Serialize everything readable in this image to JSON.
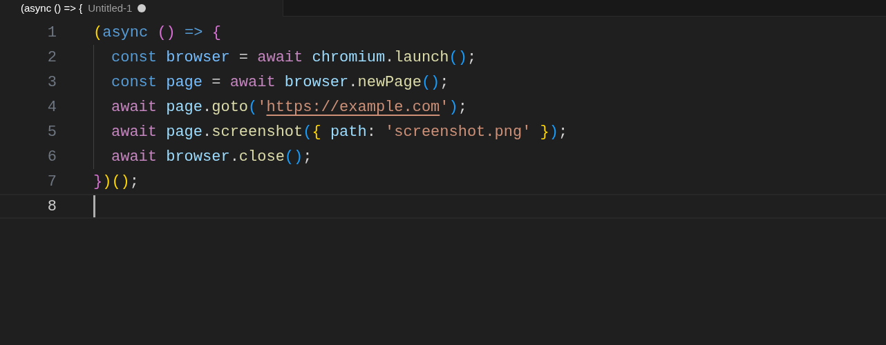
{
  "tab": {
    "title": "(async () => {",
    "subtitle": "Untitled-1",
    "dirty": true,
    "selected": true
  },
  "lines": [
    {
      "number": "1",
      "indented": false,
      "active": false,
      "tokens": [
        {
          "text": "(",
          "kind": "bracket1"
        },
        {
          "text": "async ",
          "kind": "keyword"
        },
        {
          "text": "() ",
          "kind": "bracket2"
        },
        {
          "text": "=> ",
          "kind": "keyword"
        },
        {
          "text": "{",
          "kind": "bracket2"
        }
      ]
    },
    {
      "number": "2",
      "indented": true,
      "active": false,
      "tokens": [
        {
          "text": "const ",
          "kind": "keyword"
        },
        {
          "text": "browser",
          "kind": "constant"
        },
        {
          "text": " = ",
          "kind": "plain"
        },
        {
          "text": "await ",
          "kind": "control"
        },
        {
          "text": "chromium",
          "kind": "variable"
        },
        {
          "text": ".",
          "kind": "plain"
        },
        {
          "text": "launch",
          "kind": "function"
        },
        {
          "text": "()",
          "kind": "bracket3"
        },
        {
          "text": ";",
          "kind": "plain"
        }
      ]
    },
    {
      "number": "3",
      "indented": true,
      "active": false,
      "tokens": [
        {
          "text": "const ",
          "kind": "keyword"
        },
        {
          "text": "page",
          "kind": "constant"
        },
        {
          "text": " = ",
          "kind": "plain"
        },
        {
          "text": "await ",
          "kind": "control"
        },
        {
          "text": "browser",
          "kind": "variable"
        },
        {
          "text": ".",
          "kind": "plain"
        },
        {
          "text": "newPage",
          "kind": "function"
        },
        {
          "text": "()",
          "kind": "bracket3"
        },
        {
          "text": ";",
          "kind": "plain"
        }
      ]
    },
    {
      "number": "4",
      "indented": true,
      "active": false,
      "tokens": [
        {
          "text": "await ",
          "kind": "control"
        },
        {
          "text": "page",
          "kind": "variable"
        },
        {
          "text": ".",
          "kind": "plain"
        },
        {
          "text": "goto",
          "kind": "function"
        },
        {
          "text": "(",
          "kind": "bracket3"
        },
        {
          "text": "'",
          "kind": "string"
        },
        {
          "text": "https://example.com",
          "kind": "link"
        },
        {
          "text": "'",
          "kind": "string"
        },
        {
          "text": ")",
          "kind": "bracket3"
        },
        {
          "text": ";",
          "kind": "plain"
        }
      ]
    },
    {
      "number": "5",
      "indented": true,
      "active": false,
      "tokens": [
        {
          "text": "await ",
          "kind": "control"
        },
        {
          "text": "page",
          "kind": "variable"
        },
        {
          "text": ".",
          "kind": "plain"
        },
        {
          "text": "screenshot",
          "kind": "function"
        },
        {
          "text": "(",
          "kind": "bracket3"
        },
        {
          "text": "{ ",
          "kind": "bracket1"
        },
        {
          "text": "path",
          "kind": "variable"
        },
        {
          "text": ": ",
          "kind": "plain"
        },
        {
          "text": "'screenshot.png' ",
          "kind": "string"
        },
        {
          "text": "}",
          "kind": "bracket1"
        },
        {
          "text": ")",
          "kind": "bracket3"
        },
        {
          "text": ";",
          "kind": "plain"
        }
      ]
    },
    {
      "number": "6",
      "indented": true,
      "active": false,
      "tokens": [
        {
          "text": "await ",
          "kind": "control"
        },
        {
          "text": "browser",
          "kind": "variable"
        },
        {
          "text": ".",
          "kind": "plain"
        },
        {
          "text": "close",
          "kind": "function"
        },
        {
          "text": "()",
          "kind": "bracket3"
        },
        {
          "text": ";",
          "kind": "plain"
        }
      ]
    },
    {
      "number": "7",
      "indented": false,
      "active": false,
      "tokens": [
        {
          "text": "}",
          "kind": "bracket2"
        },
        {
          "text": ")()",
          "kind": "bracket1"
        },
        {
          "text": ";",
          "kind": "plain"
        }
      ]
    },
    {
      "number": "8",
      "indented": false,
      "active": true
    }
  ]
}
